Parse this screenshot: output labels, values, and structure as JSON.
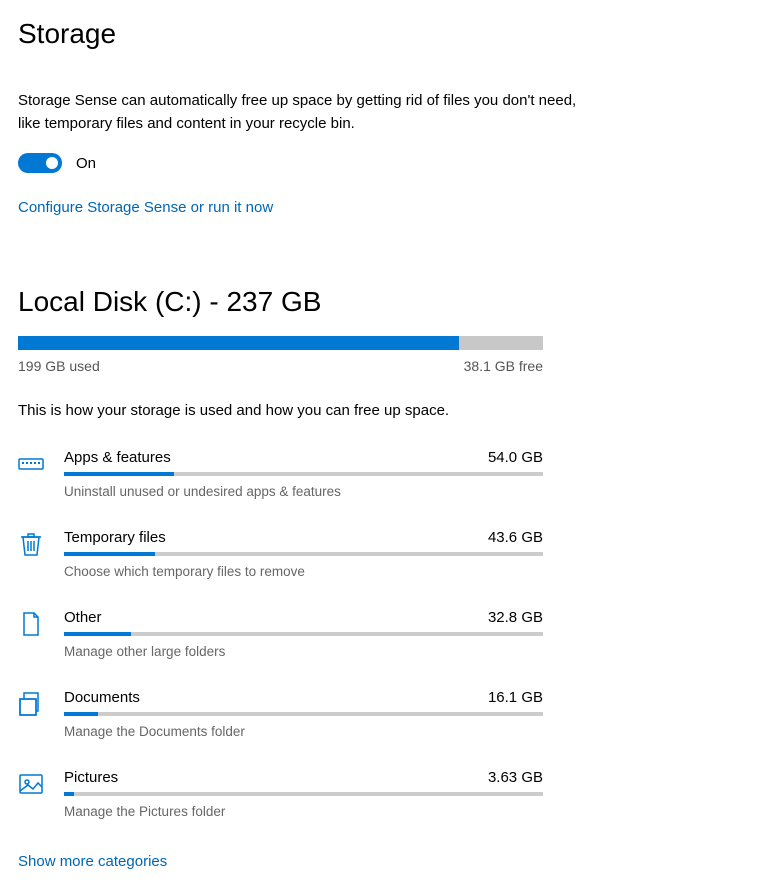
{
  "header": {
    "title": "Storage"
  },
  "sense": {
    "description": "Storage Sense can automatically free up space by getting rid of files you don't need, like temporary files and content in your recycle bin.",
    "toggle_state": "On",
    "configure_link": "Configure Storage Sense or run it now"
  },
  "disk": {
    "title": "Local Disk (C:) - 237 GB",
    "used_label": "199 GB used",
    "free_label": "38.1 GB free",
    "used_pct": 84,
    "usage_description": "This is how your storage is used and how you can free up space."
  },
  "categories": [
    {
      "name": "Apps & features",
      "size": "54.0 GB",
      "hint": "Uninstall unused or undesired apps & features",
      "pct": 23,
      "icon": "apps"
    },
    {
      "name": "Temporary files",
      "size": "43.6 GB",
      "hint": "Choose which temporary files to remove",
      "pct": 19,
      "icon": "trash"
    },
    {
      "name": "Other",
      "size": "32.8 GB",
      "hint": "Manage other large folders",
      "pct": 14,
      "icon": "other"
    },
    {
      "name": "Documents",
      "size": "16.1 GB",
      "hint": "Manage the Documents folder",
      "pct": 7,
      "icon": "documents"
    },
    {
      "name": "Pictures",
      "size": "3.63 GB",
      "hint": "Manage the Pictures folder",
      "pct": 2,
      "icon": "pictures"
    }
  ],
  "show_more": "Show more categories"
}
